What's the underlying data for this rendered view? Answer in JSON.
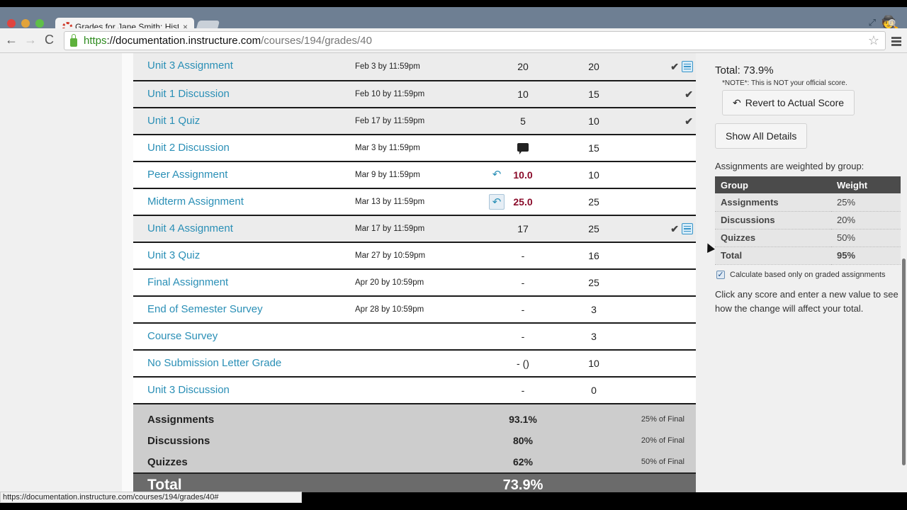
{
  "browser": {
    "tab_title": "Grades for Jane Smith: Hist",
    "tab_close": "×",
    "url_scheme": "https",
    "url_host": "://documentation.instructure.com",
    "url_path": "/courses/194/grades/40",
    "status_url": "https://documentation.instructure.com/courses/194/grades/40#",
    "icons": {
      "back": "←",
      "forward": "→",
      "reload": "C",
      "star": "☆",
      "incognito": "🕵",
      "fullscreen": "⤢"
    }
  },
  "assignments": [
    {
      "name": "Unit 3 Assignment",
      "due": "Feb 3 by 11:59pm",
      "score": "20",
      "possible": "20",
      "shaded": true,
      "icons": [
        "check",
        "rubric"
      ]
    },
    {
      "name": "Unit 1 Discussion",
      "due": "Feb 10 by 11:59pm",
      "score": "10",
      "possible": "15",
      "shaded": true,
      "icons": [
        "check"
      ]
    },
    {
      "name": "Unit 1 Quiz",
      "due": "Feb 17 by 11:59pm",
      "score": "5",
      "possible": "10",
      "shaded": true,
      "icons": [
        "check"
      ]
    },
    {
      "name": "Unit 2 Discussion",
      "due": "Mar 3 by 11:59pm",
      "score": "",
      "possible": "15",
      "score_icon": "comment"
    },
    {
      "name": "Peer Assignment",
      "due": "Mar 9 by 11:59pm",
      "score": "10.0",
      "possible": "10",
      "changed": true,
      "revert": "plain"
    },
    {
      "name": "Midterm Assignment",
      "due": "Mar 13 by 11:59pm",
      "score": "25.0",
      "possible": "25",
      "changed": true,
      "revert": "boxed"
    },
    {
      "name": "Unit 4 Assignment",
      "due": "Mar 17 by 11:59pm",
      "score": "17",
      "possible": "25",
      "shaded": true,
      "icons": [
        "check",
        "rubric"
      ]
    },
    {
      "name": "Unit 3 Quiz",
      "due": "Mar 27 by 10:59pm",
      "score": "-",
      "possible": "16"
    },
    {
      "name": "Final Assignment",
      "due": "Apr 20 by 10:59pm",
      "score": "-",
      "possible": "25"
    },
    {
      "name": "End of Semester Survey",
      "due": "Apr 28 by 10:59pm",
      "score": "-",
      "possible": "3"
    },
    {
      "name": "Course Survey",
      "due": "",
      "score": "-",
      "possible": "3"
    },
    {
      "name": "No Submission Letter Grade",
      "due": "",
      "score": "- ()",
      "possible": "10"
    },
    {
      "name": "Unit 3 Discussion",
      "due": "",
      "score": "-",
      "possible": "0"
    }
  ],
  "summary": [
    {
      "name": "Assignments",
      "percent": "93.1%",
      "weight": "25% of Final"
    },
    {
      "name": "Discussions",
      "percent": "80%",
      "weight": "20% of Final"
    },
    {
      "name": "Quizzes",
      "percent": "62%",
      "weight": "50% of Final"
    }
  ],
  "total": {
    "label": "Total",
    "percent": "73.9%"
  },
  "sidebar": {
    "total": "Total: 73.9%",
    "note": "*NOTE*: This is NOT your official score.",
    "revert_button": "Revert to Actual Score",
    "details_button": "Show All Details",
    "weighted_label": "Assignments are weighted by group:",
    "weights_header": {
      "group": "Group",
      "weight": "Weight"
    },
    "weights": [
      {
        "group": "Assignments",
        "weight": "25%"
      },
      {
        "group": "Discussions",
        "weight": "20%"
      },
      {
        "group": "Quizzes",
        "weight": "50%"
      }
    ],
    "weights_total": {
      "group": "Total",
      "weight": "95%"
    },
    "calc_label": "Calculate based only on graded assignments",
    "calc_checked": true,
    "help": "Click any score and enter a new value to see how the change will affect your total."
  },
  "colors": {
    "link": "#2a8fb6",
    "changed_score": "#8a0b2a",
    "total_bar": "#6b6b6b"
  }
}
